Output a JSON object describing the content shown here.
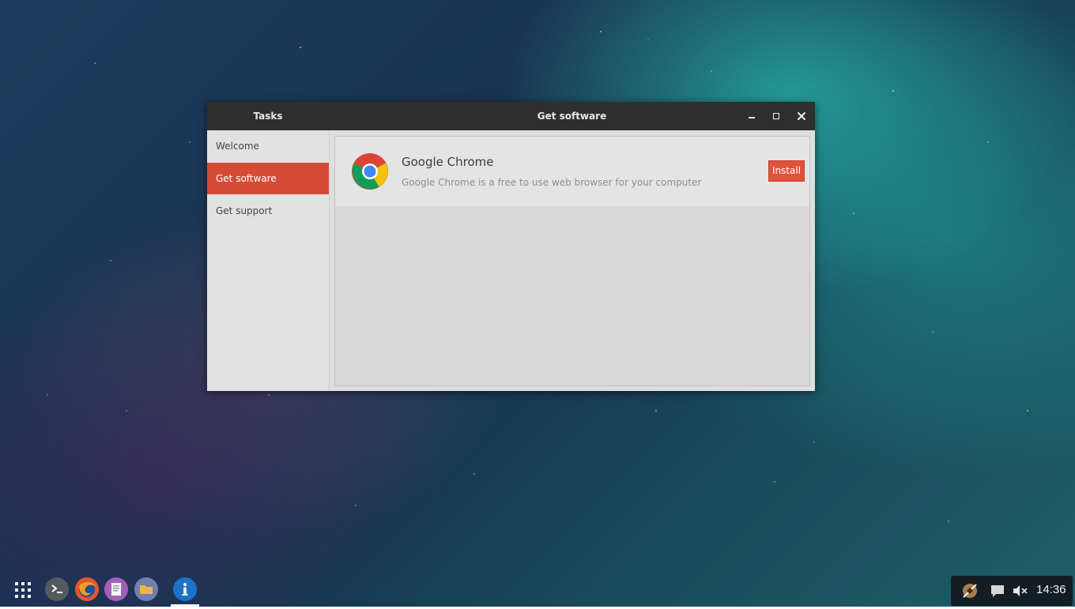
{
  "window": {
    "sidebar_title": "Tasks",
    "title": "Get software"
  },
  "sidebar": {
    "items": [
      {
        "label": "Welcome"
      },
      {
        "label": "Get software"
      },
      {
        "label": "Get support"
      }
    ]
  },
  "software": {
    "apps": [
      {
        "name": "Google Chrome",
        "description": "Google Chrome is a free to use web browser for your computer",
        "action_label": "Install",
        "icon": "chrome-icon"
      }
    ]
  },
  "taskbar": {
    "launcher_icon": "app-grid-icon",
    "dock": [
      "terminal-icon",
      "firefox-icon",
      "text-editor-icon",
      "files-icon",
      "info-icon"
    ],
    "tray": {
      "clock": "14:36",
      "icons": [
        "network-icon",
        "notifications-icon",
        "volume-muted-icon"
      ]
    }
  },
  "colors": {
    "accent": "#d64b35",
    "install_button": "#e4503c",
    "titlebar": "#2f2f2f"
  }
}
